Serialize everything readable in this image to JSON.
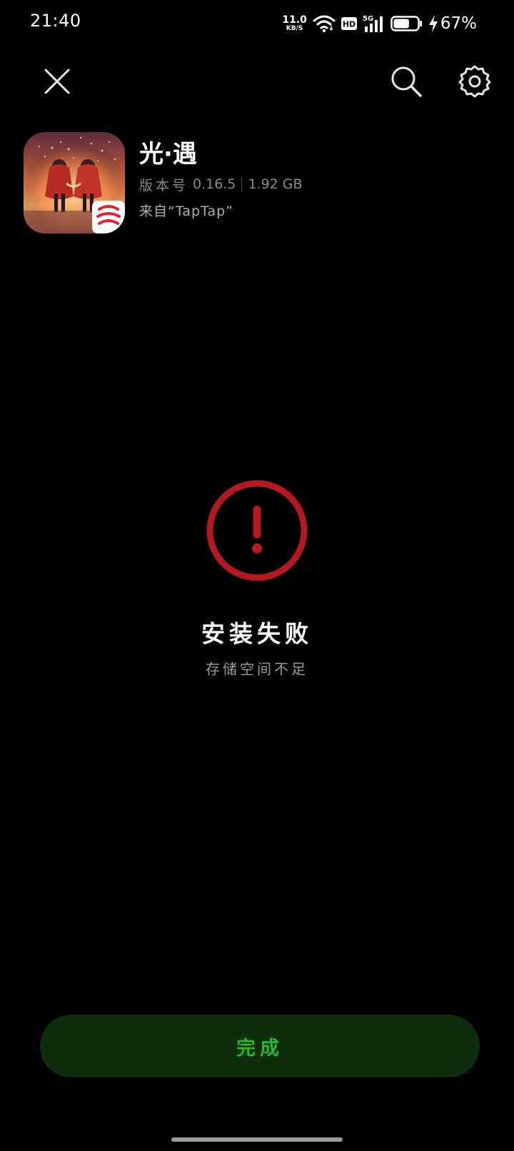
{
  "status_bar": {
    "time": "21:40",
    "net_speed_value": "11.0",
    "net_speed_unit": "KB/S",
    "hd_label": "HD",
    "signal_label": "5G",
    "battery_percent": "67%",
    "battery_level": 0.67,
    "charging": true
  },
  "top_bar": {
    "close_icon": "close-icon",
    "search_icon": "search-icon",
    "settings_icon": "gear-icon"
  },
  "app": {
    "name": "光·遇",
    "version_label": "版本号",
    "version": "0.16.5",
    "size": "1.92 GB",
    "source": "来自“TapTap”"
  },
  "result": {
    "icon": "error-exclamation-icon",
    "title": "安装失败",
    "reason": "存储空间不足",
    "accent_color": "#b3191e"
  },
  "actions": {
    "done_label": "完成",
    "done_text_color": "#2fb52d",
    "done_bg_color": "#0f2e0e"
  }
}
